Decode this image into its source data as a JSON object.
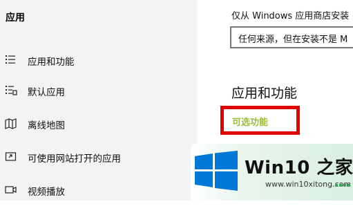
{
  "sidebar": {
    "title": "应用",
    "items": [
      {
        "label": "应用和功能",
        "icon": "list-icon"
      },
      {
        "label": "默认应用",
        "icon": "default-apps-icon"
      },
      {
        "label": "离线地图",
        "icon": "map-icon"
      },
      {
        "label": "可使用网站打开的应用",
        "icon": "link-window-icon"
      },
      {
        "label": "视频播放",
        "icon": "video-icon"
      }
    ]
  },
  "main": {
    "install_note": "仅从 Windows 应用商店安装",
    "install_source": {
      "selected": "任何来源，但在安装不是 M"
    },
    "section_heading": "应用和功能",
    "optional_features_link": "可选功能"
  },
  "watermark": {
    "brand_text": "Win10 之家",
    "url": "www.win10xitong.com"
  },
  "colors": {
    "sidebar_bg": "#f3f3f3",
    "link": "#9bbd3a",
    "highlight": "#e00000",
    "win_blue": "#0078d7"
  }
}
